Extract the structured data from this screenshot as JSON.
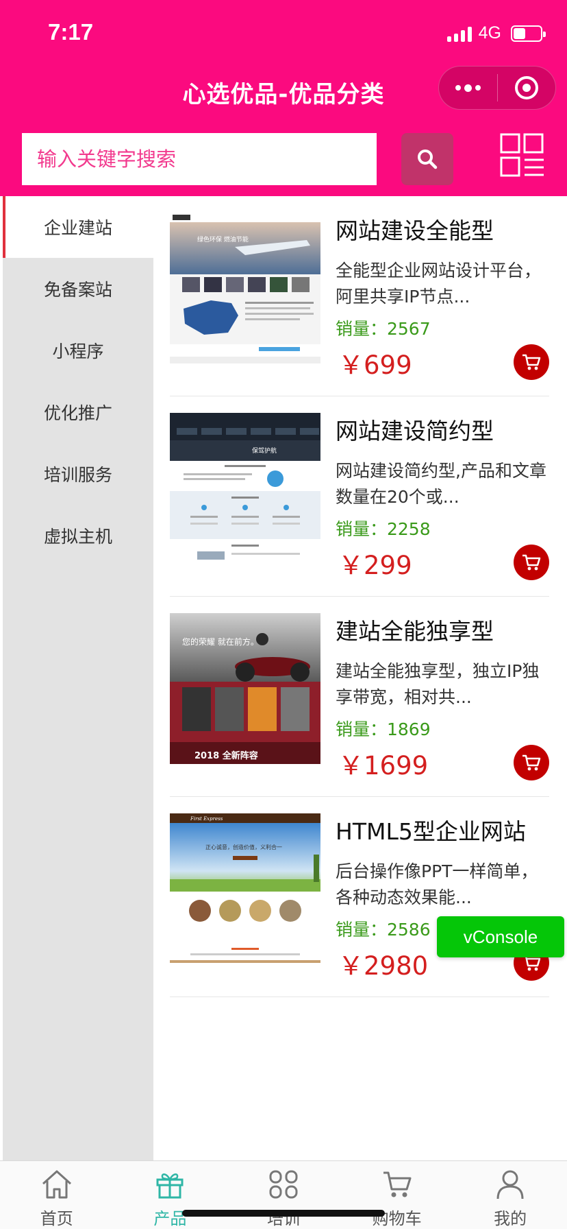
{
  "status_bar": {
    "time": "7:17",
    "network": "4G",
    "battery_level": 0.45
  },
  "nav": {
    "title": "心选优品-优品分类"
  },
  "search": {
    "placeholder": "输入关键字搜索"
  },
  "sidebar": {
    "items": [
      {
        "label": "企业建站",
        "active": true
      },
      {
        "label": "免备案站",
        "active": false
      },
      {
        "label": "小程序",
        "active": false
      },
      {
        "label": "优化推广",
        "active": false
      },
      {
        "label": "培训服务",
        "active": false
      },
      {
        "label": "虚拟主机",
        "active": false
      }
    ]
  },
  "products": [
    {
      "name": "网站建设全能型",
      "desc": "全能型企业网站设计平台，阿里共享IP节点...",
      "sales": "销量：2567",
      "price": "￥699"
    },
    {
      "name": "网站建设简约型",
      "desc": "网站建设简约型,产品和文章数量在20个或...",
      "sales": "销量：2258",
      "price": "￥299"
    },
    {
      "name": "建站全能独享型",
      "desc": "建站全能独享型，独立IP独享带宽，相对共...",
      "sales": "销量：1869",
      "price": "￥1699"
    },
    {
      "name": "HTML5型企业网站",
      "desc": "后台操作像PPT一样简单，各种动态效果能...",
      "sales": "销量：2586",
      "price": "￥2980"
    }
  ],
  "thumbnails": [
    {
      "banner_text": "绿色环保 燃油节能",
      "color": "#5a7fa8"
    },
    {
      "banner_text": "保驾护航",
      "color": "#1c2430"
    },
    {
      "banner_text": "您的荣耀 就在前方。",
      "footer_text": "2018 全新阵容",
      "color": "#8e1f2a"
    },
    {
      "banner_text": "正心诚意，创造价值，义利合一",
      "header_text": "First Express",
      "color": "#4d8fd0"
    }
  ],
  "vconsole": {
    "label": "vConsole"
  },
  "tabs": [
    {
      "label": "首页",
      "icon": "home-icon",
      "active": false
    },
    {
      "label": "产品",
      "icon": "gift-icon",
      "active": true
    },
    {
      "label": "培训",
      "icon": "grid-icon",
      "active": false
    },
    {
      "label": "购物车",
      "icon": "cart-icon",
      "active": false
    },
    {
      "label": "我的",
      "icon": "user-icon",
      "active": false
    }
  ],
  "colors": {
    "brand": "#fb0a7f",
    "price": "#d41f1f",
    "sales": "#3a9a1a",
    "tab_active": "#2fb6a6",
    "vconsole": "#05c608"
  }
}
